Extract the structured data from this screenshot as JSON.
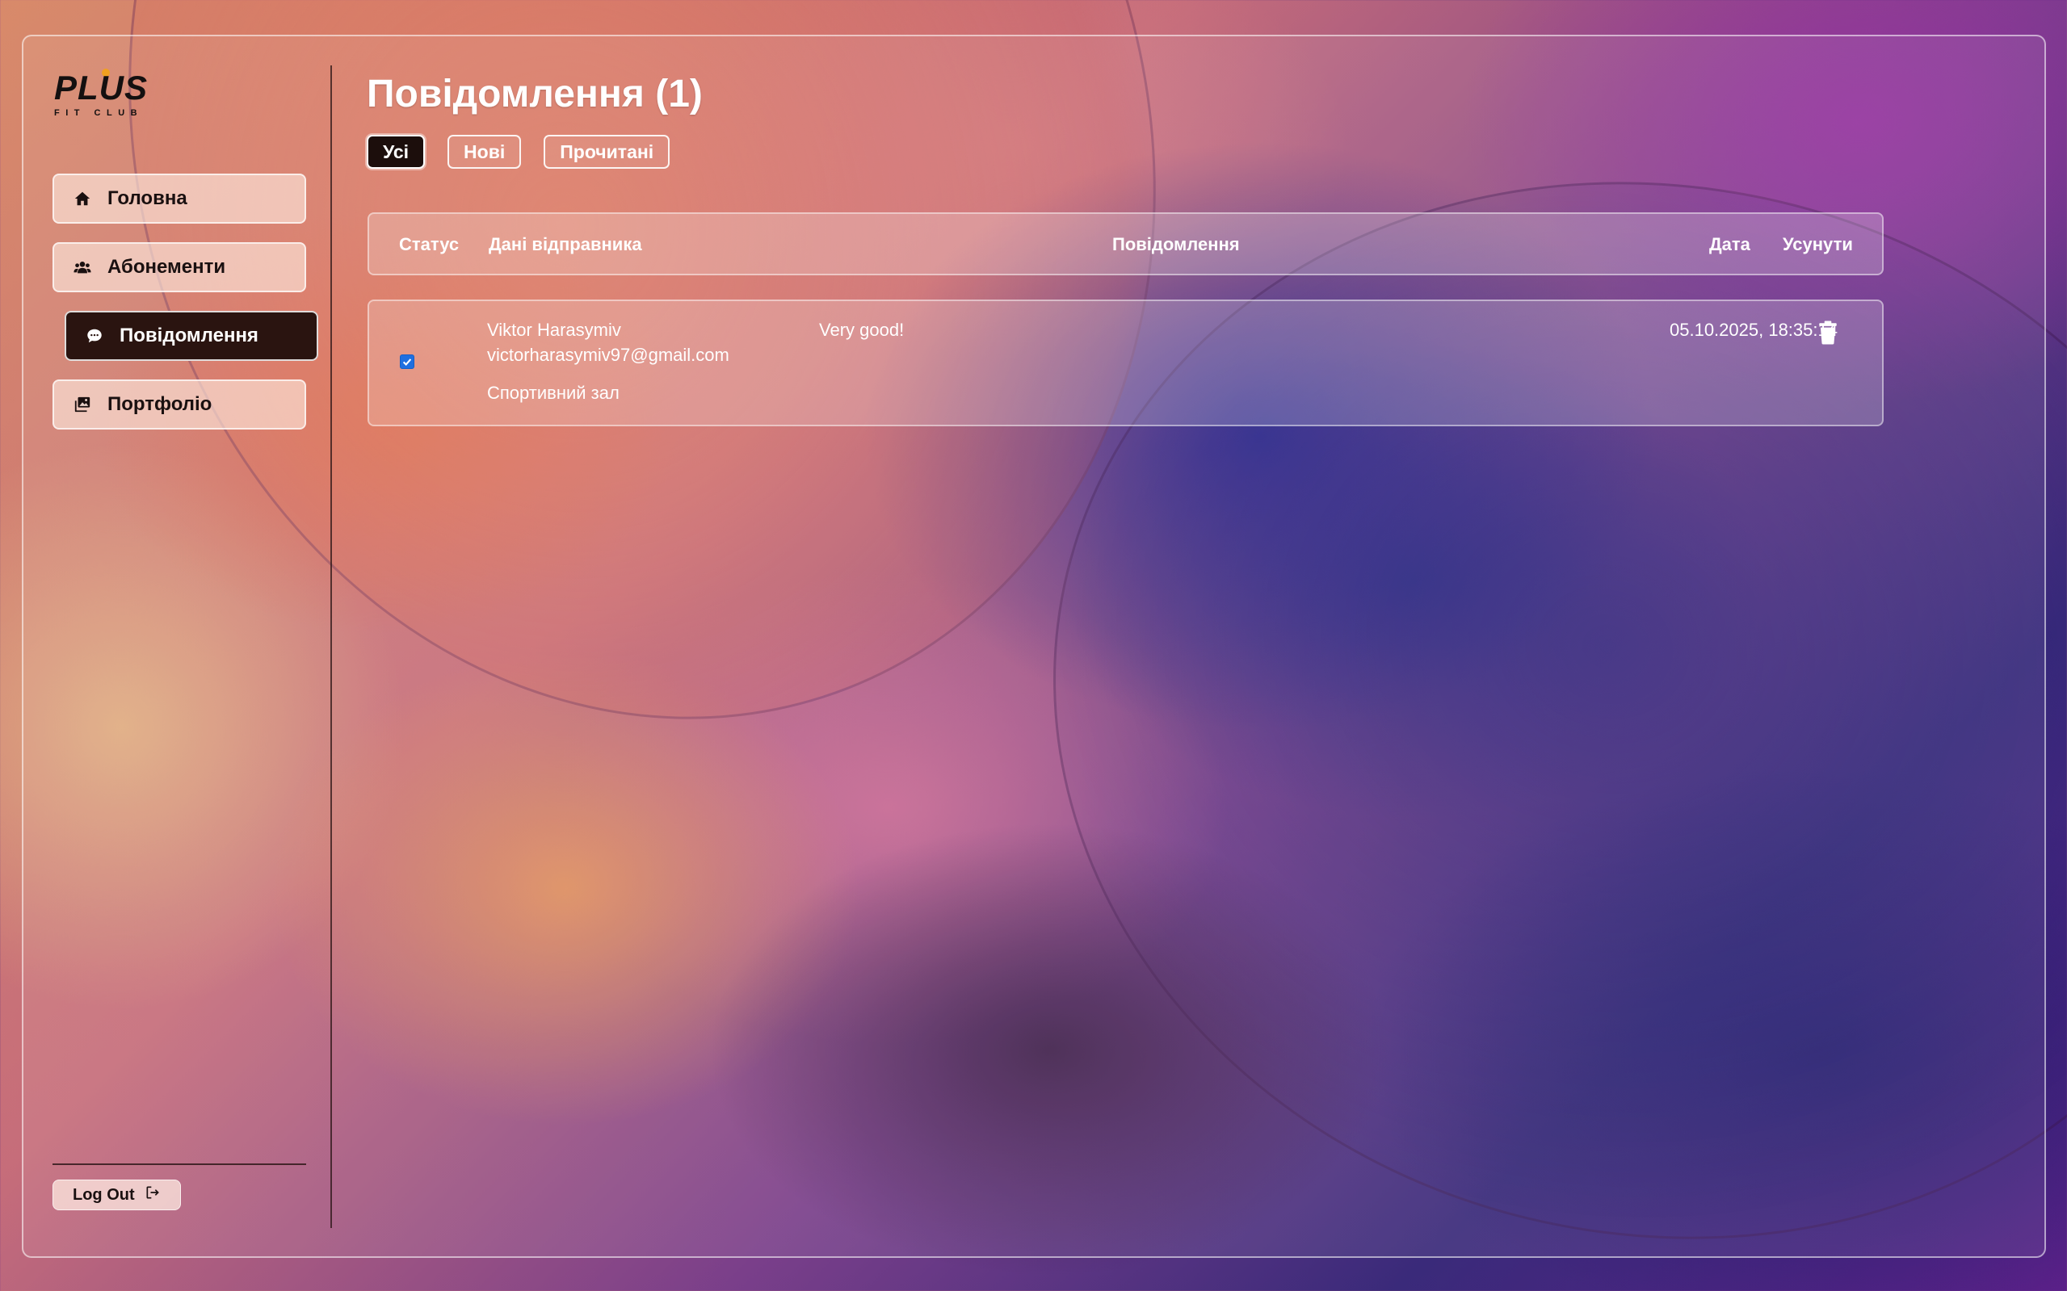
{
  "brand": {
    "logo_text": "PLUS",
    "logo_subtext": "FIT CLUB"
  },
  "sidebar": {
    "items": [
      {
        "label": "Головна",
        "icon": "home-icon"
      },
      {
        "label": "Абонементи",
        "icon": "users-icon"
      },
      {
        "label": "Повідомлення",
        "icon": "chat-icon",
        "active": true
      },
      {
        "label": "Портфоліо",
        "icon": "gallery-icon"
      }
    ],
    "logout_label": "Log Out"
  },
  "main": {
    "title": "Повідомлення (1)",
    "filters": [
      "Усі",
      "Нові",
      "Прочитані"
    ],
    "active_filter": "Усі",
    "table": {
      "headers": {
        "status": "Статус",
        "sender": "Дані відправника",
        "message": "Повідомлення",
        "date": "Дата",
        "remove": "Усунути"
      },
      "rows": [
        {
          "checked": true,
          "sender_name": "Viktor Harasymiv",
          "sender_email": "victorharasymiv97@gmail.com",
          "category": "Спортивний зал",
          "message": "Very good!",
          "date": "05.10.2025, 18:35:14"
        }
      ]
    }
  },
  "colors": {
    "active_nav_bg": "#2a1410",
    "checkbox": "#1f6fe0",
    "logo_accent": "#f0a020"
  }
}
